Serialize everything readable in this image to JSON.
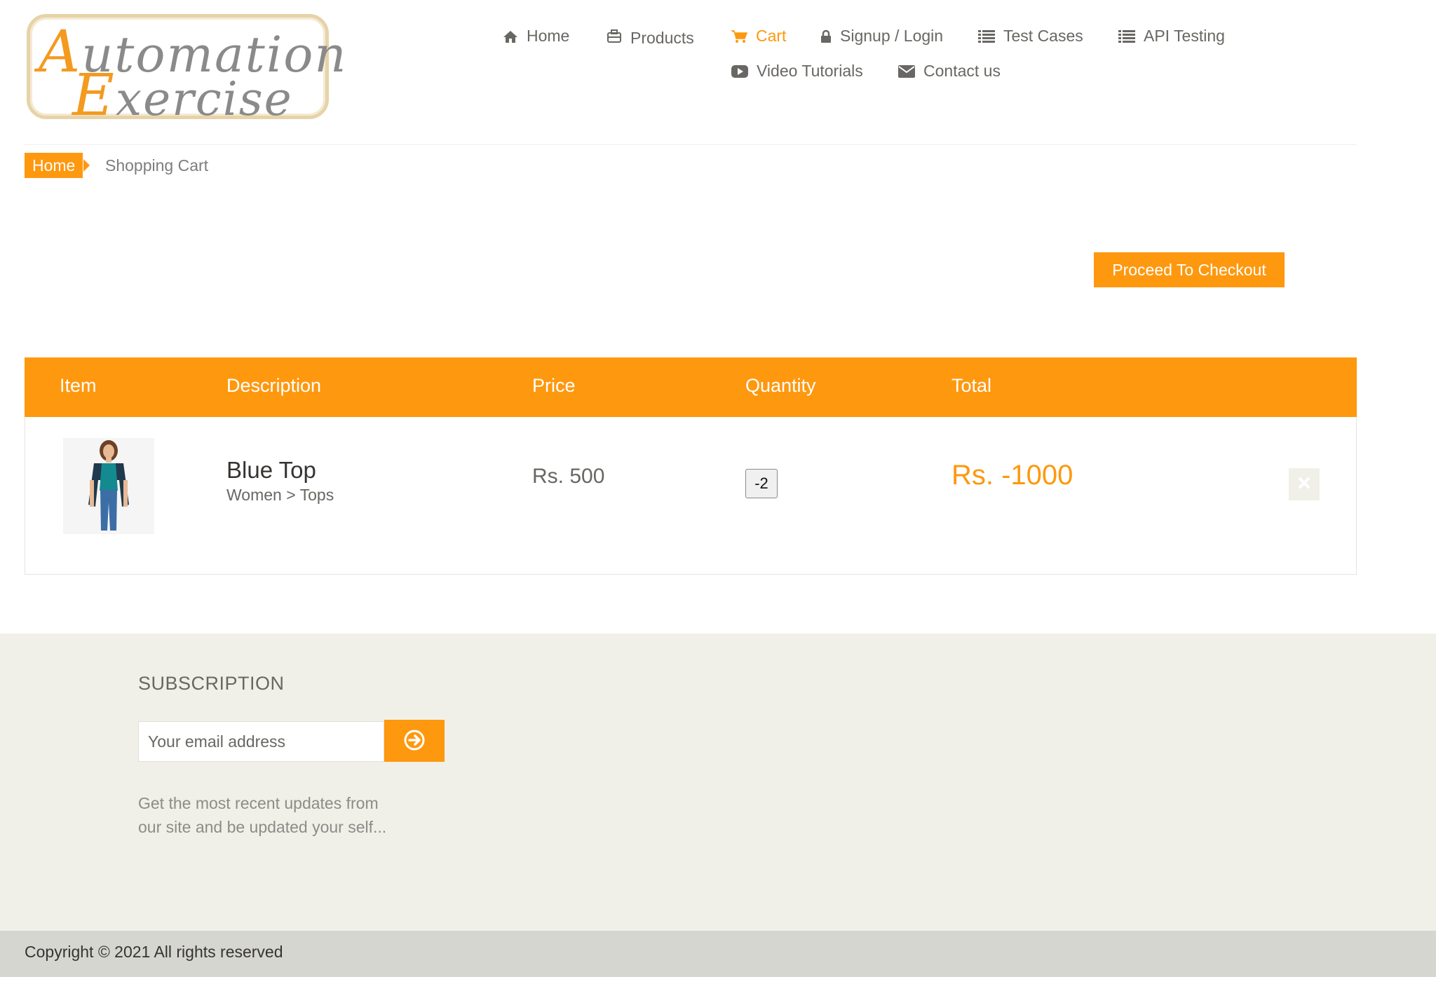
{
  "logo": {
    "line1_cap": "A",
    "line1_rest": "utomation",
    "line2_cap": "E",
    "line2_rest": "xercise"
  },
  "nav": {
    "home": "Home",
    "products": "Products",
    "cart": "Cart",
    "signup": "Signup / Login",
    "test_cases": "Test Cases",
    "api_testing": "API Testing",
    "video_tutorials": "Video Tutorials",
    "contact": "Contact us",
    "active": "Cart",
    "accent_color": "#fe980f"
  },
  "breadcrumb": {
    "home": "Home",
    "current": "Shopping Cart"
  },
  "checkout_button": "Proceed To Checkout",
  "cart": {
    "headers": [
      "Item",
      "Description",
      "Price",
      "Quantity",
      "Total"
    ],
    "items": [
      {
        "name": "Blue Top",
        "category": "Women > Tops",
        "price": "Rs. 500",
        "quantity": "-2",
        "total": "Rs. -1000",
        "image_icon": "product-woman-blue-top-image",
        "delete_icon": "close-icon"
      }
    ]
  },
  "subscription": {
    "title": "SUBSCRIPTION",
    "placeholder": "Your email address",
    "button_icon": "arrow-circle-right-icon",
    "text": "Get the most recent updates from our site and be updated your self..."
  },
  "footer": {
    "copyright": "Copyright © 2021 All rights reserved"
  },
  "colors": {
    "accent": "#fe980f",
    "footer_bg": "#f0f0e9",
    "footer_bottom": "#d6d6d0",
    "text": "#696763"
  }
}
